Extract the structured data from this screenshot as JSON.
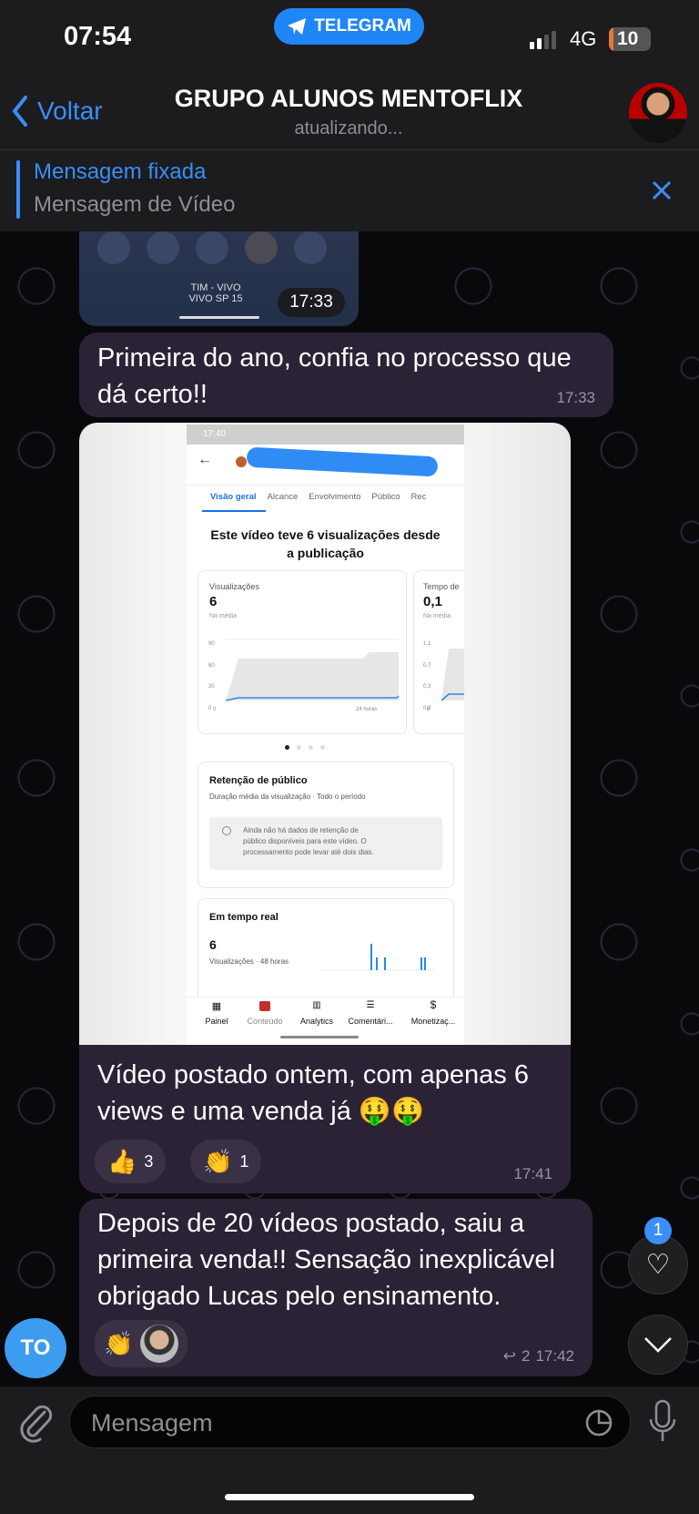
{
  "status": {
    "time": "07:54",
    "app_pill": "TELEGRAM",
    "network": "4G",
    "battery": "10"
  },
  "header": {
    "back": "Voltar",
    "title": "GRUPO ALUNOS MENTOFLIX",
    "subtitle": "atualizando..."
  },
  "pinned": {
    "label": "Mensagem fixada",
    "text": "Mensagem de Vídeo"
  },
  "messages": [
    {
      "type": "video",
      "time": "17:33",
      "overlay_line1": "TIM - VIVO",
      "overlay_line2": "VIVO SP 15"
    },
    {
      "type": "text",
      "lines": [
        "Primeira do ano, confia no processo que",
        "dá certo!!"
      ],
      "time": "17:33"
    },
    {
      "type": "photo",
      "caption_lines": [
        "Vídeo postado ontem, com apenas 6",
        "views e uma venda já 🤑🤑"
      ],
      "reactions": [
        {
          "emoji": "👍",
          "count": "3"
        },
        {
          "emoji": "👏",
          "count": "1"
        }
      ],
      "time": "17:41"
    },
    {
      "type": "text",
      "lines": [
        "Depois de 20 vídeos postado, saiu a",
        "primeira venda!! Sensação inexplicável",
        "obrigado Lucas pelo ensinamento."
      ],
      "reactions": [
        {
          "emoji": "👏"
        }
      ],
      "replies": "2",
      "time": "17:42"
    }
  ],
  "sender_avatar": "TO",
  "floating": {
    "reaction_badge": "1"
  },
  "composer": {
    "placeholder": "Mensagem"
  },
  "screenshot": {
    "status_time": "17:40",
    "tabs": [
      "Visão geral",
      "Alcance",
      "Envolvimento",
      "Público",
      "Rec"
    ],
    "active_tab": "Visão geral",
    "heading_line1": "Este vídeo teve 6 visualizações desde",
    "heading_line2": "a publicação",
    "card1": {
      "label": "Visualizações",
      "value": "6",
      "sub": "Na média",
      "yticks": [
        "90",
        "60",
        "30",
        "0"
      ],
      "x_start": "0",
      "x_end": "24 horas"
    },
    "card2": {
      "label": "Tempo de",
      "value": "0,1",
      "sub": "Na média",
      "yticks": [
        "1,1",
        "0,7",
        "0,3",
        "0,0"
      ],
      "x_start": "0"
    },
    "retention": {
      "title": "Retenção de público",
      "sub": "Duração média da visualização · Todo o período",
      "notice": [
        "Ainda não há dados de retenção de",
        "público disponíveis para este vídeo. O",
        "processamento pode levar até dois dias."
      ]
    },
    "realtime": {
      "title": "Em tempo real",
      "value": "6",
      "sub": "Visualizações · 48 horas"
    },
    "nav": [
      "Painel",
      "Conteúdo",
      "Analytics",
      "Comentári...",
      "Monetizaç..."
    ],
    "accent": "#1a73e8"
  },
  "colors": {
    "accent": "#2f8cf5",
    "bubble": "#2b2236",
    "header": "#1c1c1e"
  }
}
